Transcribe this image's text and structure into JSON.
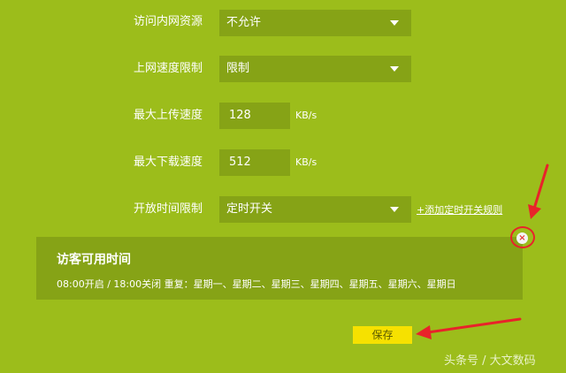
{
  "form": {
    "intranet_access": {
      "label": "访问内网资源",
      "value": "不允许"
    },
    "speed_limit": {
      "label": "上网速度限制",
      "value": "限制"
    },
    "upload": {
      "label": "最大上传速度",
      "value": "128",
      "unit": "KB/s"
    },
    "download": {
      "label": "最大下载速度",
      "value": "512",
      "unit": "KB/s"
    },
    "open_time": {
      "label": "开放时间限制",
      "value": "定时开关",
      "add_rule_link": "+添加定时开关规则"
    }
  },
  "guest_time_panel": {
    "title": "访客可用时间",
    "detail": "08:00开启 / 18:00关闭   重复：星期一、星期二、星期三、星期四、星期五、星期六、星期日"
  },
  "icons": {
    "delete": "close-circle-icon",
    "caret": "chevron-down-icon"
  },
  "save_button": {
    "label": "保存"
  },
  "watermark": "头条号 / 大文数码",
  "colors": {
    "background": "#9cbd1b",
    "field": "#86a316",
    "save_button": "#f6e100",
    "annotation": "#e8232a"
  }
}
